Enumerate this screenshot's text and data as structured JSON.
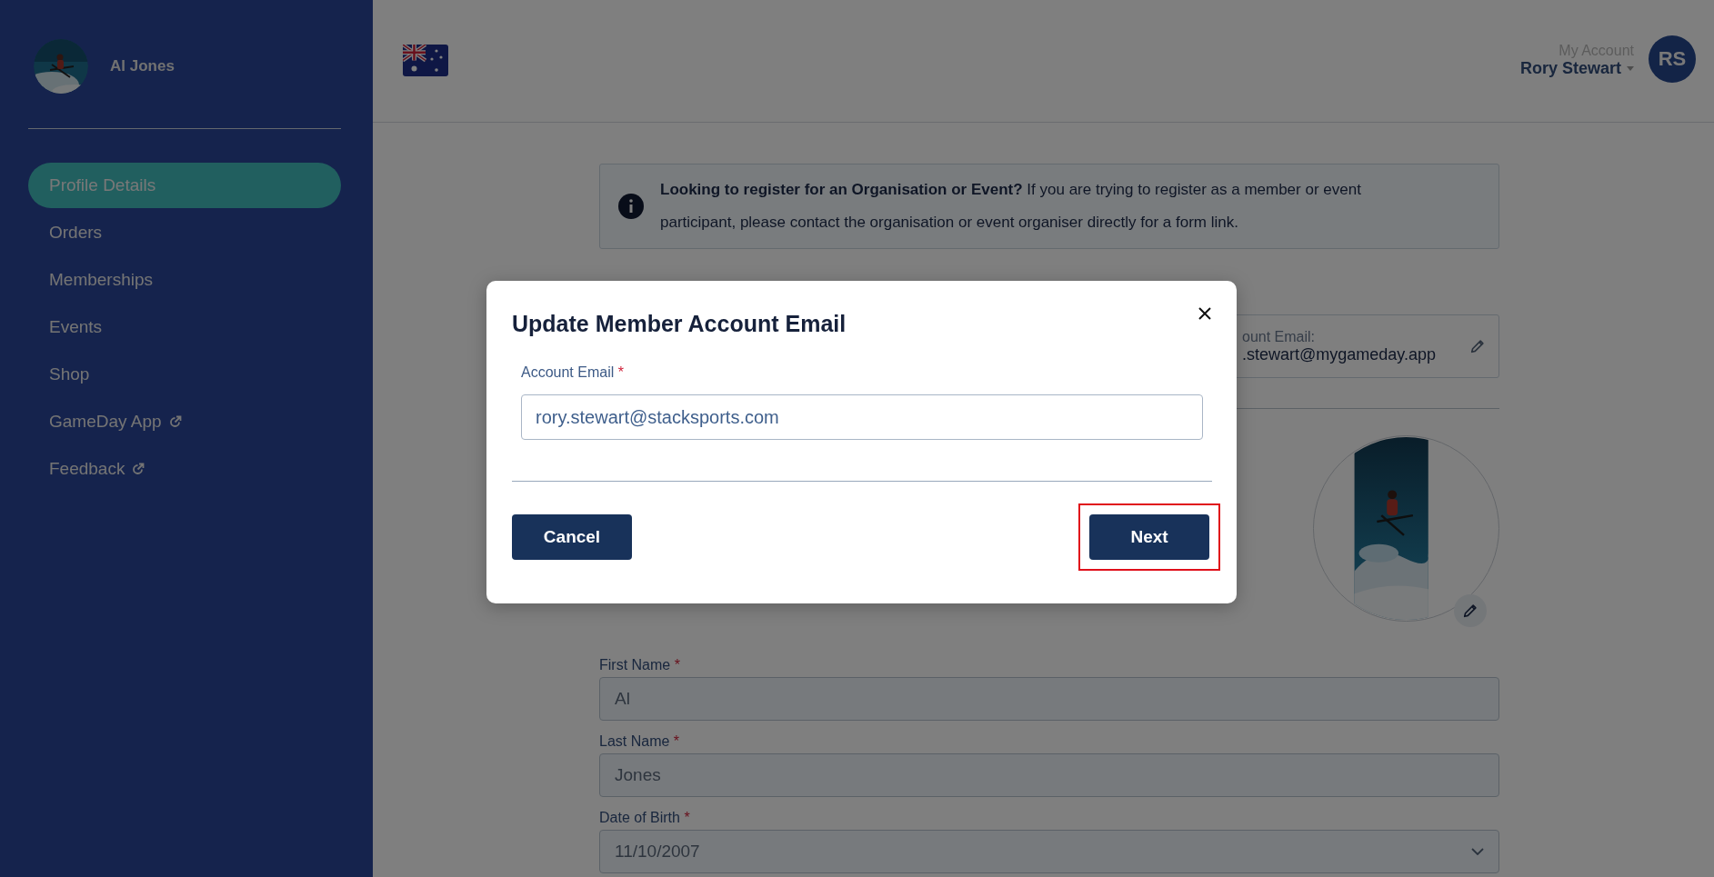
{
  "sidebar": {
    "user_name": "Al Jones",
    "items": [
      {
        "label": "Profile Details",
        "selected": true,
        "external": false
      },
      {
        "label": "Orders",
        "selected": false,
        "external": false
      },
      {
        "label": "Memberships",
        "selected": false,
        "external": false
      },
      {
        "label": "Events",
        "selected": false,
        "external": false
      },
      {
        "label": "Shop",
        "selected": false,
        "external": false
      },
      {
        "label": "GameDay App",
        "selected": false,
        "external": true
      },
      {
        "label": "Feedback",
        "selected": false,
        "external": true
      }
    ]
  },
  "header": {
    "account_label": "My Account",
    "user_name": "Rory Stewart",
    "avatar_initials": "RS"
  },
  "info_banner": {
    "text": "**Looking to register for an Organisation or Event?** If you are trying to register as a member or event participant, please contact the organisation or event organiser directly for a form link."
  },
  "account_email": {
    "label": "ount Email:",
    "value": ".stewart@mygameday.app"
  },
  "profile_form": {
    "fields": [
      {
        "kind": "text",
        "label": "First Name",
        "required_mark": "*",
        "value": "Al",
        "disabled": true
      },
      {
        "kind": "text",
        "label": "Last Name",
        "required_mark": "*",
        "value": "Jones",
        "disabled": true
      },
      {
        "kind": "select",
        "label": "Date of Birth",
        "required_mark": "*",
        "value": "11/10/2007",
        "disabled": true
      }
    ]
  },
  "modal": {
    "title": "Update Member Account Email",
    "field": {
      "label": "Account Email",
      "required_mark": "*",
      "value": "rory.stewart@stacksports.com"
    },
    "buttons": [
      {
        "label": "Cancel",
        "highlighted": false
      },
      {
        "label": "Next",
        "highlighted": true
      }
    ]
  }
}
